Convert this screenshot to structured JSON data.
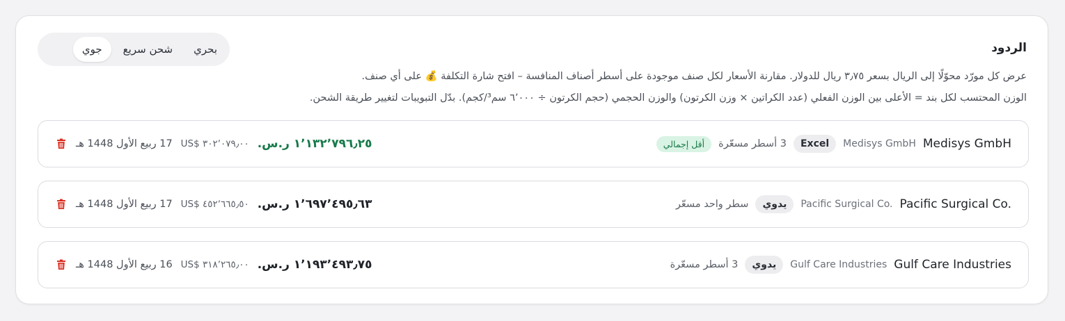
{
  "section": {
    "title": "الردود",
    "description_line1": "عرض كل مورّد محوّلًا إلى الريال بسعر ٣٫٧٥ ريال للدولار. مقارنة الأسعار لكل صنف موجودة على أسطر أصناف المنافسة – افتح شارة التكلفة 💰 على أي صنف.",
    "description_line2": "الوزن المحتسب لكل بند = الأعلى بين الوزن الفعلي (عدد الكراتين × وزن الكرتون) والوزن الحجمي (حجم الكرتون ÷ ٦٬٠٠٠ سم³/كجم). بدّل التبويبات لتغيير طريقة الشحن."
  },
  "tabs": [
    {
      "label": "جوي",
      "active": true
    },
    {
      "label": "شحن سريع",
      "active": false
    },
    {
      "label": "بحري",
      "active": false
    }
  ],
  "rows": [
    {
      "supplier_name": "Medisys GmbH",
      "supplier_sub": "Medisys GmbH",
      "source": "Excel",
      "lines": "3 أسطر مسعّرة",
      "lowest_label": "أقل إجمالي",
      "total_sar": "١٬١٣٢٬٧٩٦٫٢٥ ر.س.",
      "total_usd": "US$ ٣٠٢٬٠٧٩٫٠٠",
      "date": "17 ربيع الأول 1448 هـ",
      "is_best": true
    },
    {
      "supplier_name": "Pacific Surgical Co.",
      "supplier_sub": "Pacific Surgical Co.",
      "source": "يدوي",
      "lines": "سطر واحد مسعّر",
      "lowest_label": "",
      "total_sar": "١٬٦٩٧٬٤٩٥٫٦٣ ر.س.",
      "total_usd": "US$ ٤٥٢٬٦٦٥٫٥٠",
      "date": "17 ربيع الأول 1448 هـ",
      "is_best": false
    },
    {
      "supplier_name": "Gulf Care Industries",
      "supplier_sub": "Gulf Care Industries",
      "source": "يدوي",
      "lines": "3 أسطر مسعّرة",
      "lowest_label": "",
      "total_sar": "١٬١٩٣٬٤٩٣٫٧٥ ر.س.",
      "total_usd": "US$ ٣١٨٬٢٦٥٫٠٠",
      "date": "16 ربيع الأول 1448 هـ",
      "is_best": false
    }
  ],
  "colors": {
    "best_total": "#187a4a",
    "lowest_badge_bg": "#d9f3e4",
    "trash": "#d92d20"
  },
  "icons": {
    "delete": "trash-icon",
    "cost": "money-bag-emoji"
  }
}
